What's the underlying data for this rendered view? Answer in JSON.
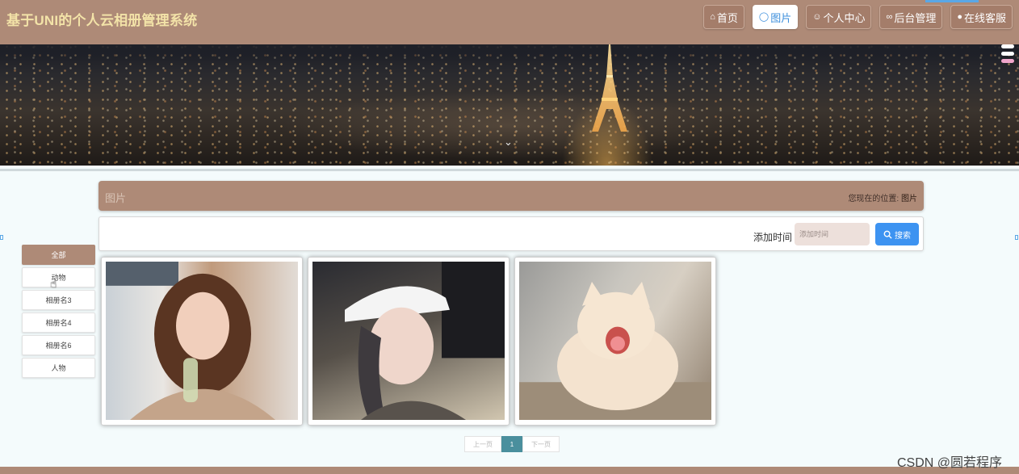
{
  "header": {
    "title": "基于UNI的个人云相册管理系统",
    "nav": [
      {
        "label": "首页",
        "icon": "home-icon",
        "active": false
      },
      {
        "label": "图片",
        "icon": "image-icon",
        "active": true
      },
      {
        "label": "个人中心",
        "icon": "user-icon",
        "active": false
      },
      {
        "label": "后台管理",
        "icon": "link-icon",
        "active": false
      },
      {
        "label": "在线客服",
        "icon": "chat-icon",
        "active": false
      }
    ]
  },
  "banner": {
    "slides": 3,
    "active_slide": 3,
    "scroll_hint_icon": "chevron-down-icon"
  },
  "section": {
    "title": "图片",
    "breadcrumb_prefix": "您现在的位置:",
    "breadcrumb_current": "图片"
  },
  "search": {
    "label": "添加时间",
    "placeholder": "添加时间",
    "value": "",
    "button_label": "搜索"
  },
  "sidebar": {
    "items": [
      {
        "label": "全部",
        "active": true
      },
      {
        "label": "动物",
        "active": false
      },
      {
        "label": "相册名3",
        "active": false
      },
      {
        "label": "相册名4",
        "active": false
      },
      {
        "label": "相册名6",
        "active": false
      },
      {
        "label": "人物",
        "active": false
      }
    ]
  },
  "gallery": {
    "items": [
      {
        "alt": "photo-portrait-smiling-girl"
      },
      {
        "alt": "photo-girl-white-cap"
      },
      {
        "alt": "photo-yawning-cat"
      }
    ]
  },
  "pagination": {
    "prev_label": "上一页",
    "current_label": "1",
    "next_label": "下一页"
  },
  "watermark": "CSDN @圆若程序",
  "colors": {
    "brand": "#ae8a77",
    "title": "#f3e3a8",
    "accent": "#3d93f1",
    "page_active": "#4a8f9d",
    "background": "#f4fbfc"
  }
}
